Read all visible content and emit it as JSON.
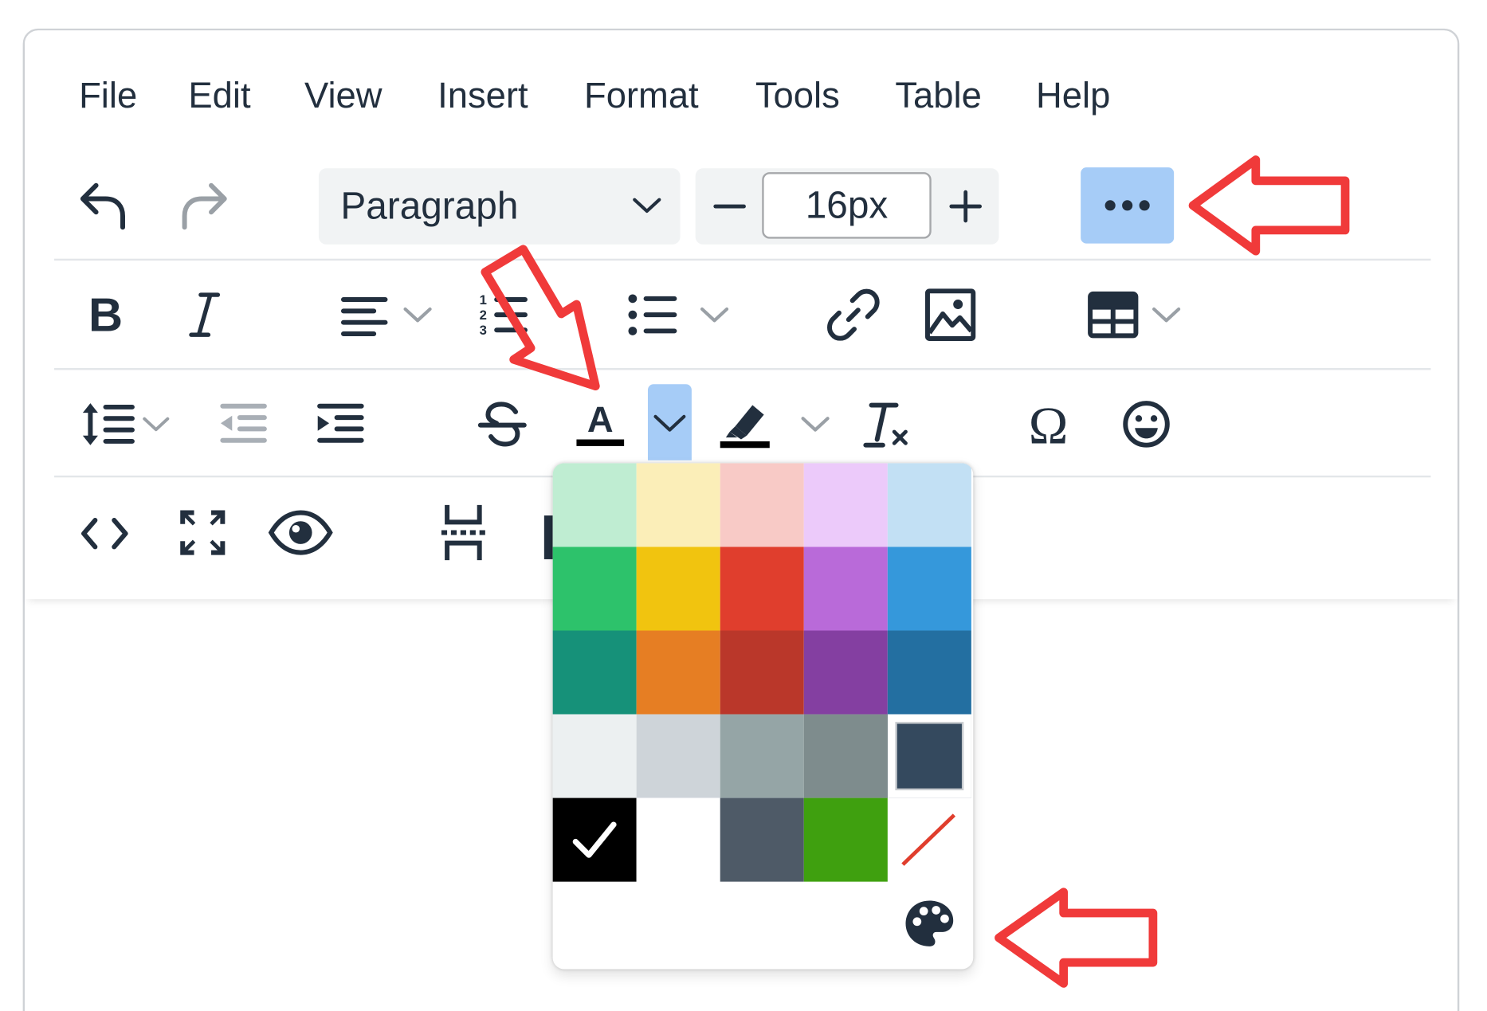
{
  "menubar": {
    "items": [
      "File",
      "Edit",
      "View",
      "Insert",
      "Format",
      "Tools",
      "Table",
      "Help"
    ]
  },
  "toolbar": {
    "block_format": "Paragraph",
    "font_size": "16px"
  },
  "icons": {
    "row1": [
      "undo-icon",
      "redo-icon",
      "chevron-down-icon",
      "minus-icon",
      "plus-icon",
      "more-icon"
    ],
    "row2": [
      "bold-icon",
      "italic-icon",
      "align-left-icon",
      "numbered-list-icon",
      "bullet-list-icon",
      "link-icon",
      "image-icon",
      "table-icon"
    ],
    "row3": [
      "line-height-icon",
      "outdent-icon",
      "indent-icon",
      "strikethrough-icon",
      "text-color-icon",
      "highlight-icon",
      "clear-formatting-icon",
      "special-character-icon",
      "emoji-icon"
    ],
    "row4": [
      "source-code-icon",
      "fullscreen-icon",
      "preview-icon",
      "page-break-icon"
    ]
  },
  "color_palette": {
    "selected": "#000000",
    "rows": [
      [
        "#bfedd2",
        "#fbeeb8",
        "#f8cac6",
        "#eccafa",
        "#c2e0f4"
      ],
      [
        "#2dc26b",
        "#f1c40f",
        "#e03e2d",
        "#b96ad9",
        "#3598db"
      ],
      [
        "#169179",
        "#e67e23",
        "#ba372a",
        "#843fa1",
        "#236fa1"
      ],
      [
        "#ecf0f1",
        "#ced4d9",
        "#95a5a6",
        "#7e8c8d",
        "#34495e"
      ],
      [
        "#000000",
        "#ffffff",
        "#4e5a67",
        "#3fa00f",
        "remove-color"
      ]
    ],
    "custom_icon": "palette-icon"
  },
  "annotation_color": "#f03a3a",
  "active_color": "#a6ccf7",
  "icon_color": "#222f3e"
}
